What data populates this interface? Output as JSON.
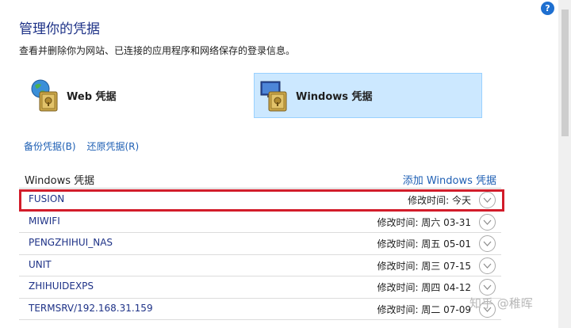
{
  "header": {
    "title": "管理你的凭据",
    "subtitle": "查看并删除你为网站、已连接的应用程序和网络保存的登录信息。",
    "help_glyph": "?"
  },
  "tiles": {
    "web_label": "Web 凭据",
    "windows_label": "Windows 凭据"
  },
  "links": {
    "backup": "备份凭据(B)",
    "restore": "还原凭据(R)"
  },
  "section": {
    "title": "Windows 凭据",
    "add_link": "添加 Windows 凭据"
  },
  "credentials": [
    {
      "name": "FUSION",
      "modified": "修改时间: 今天"
    },
    {
      "name": "MIWIFI",
      "modified": "修改时间: 周六 03-31"
    },
    {
      "name": "PENGZHIHUI_NAS",
      "modified": "修改时间: 周五 05-01"
    },
    {
      "name": "UNIT",
      "modified": "修改时间: 周三 07-15"
    },
    {
      "name": "ZHIHUIDEXPS",
      "modified": "修改时间: 周四 04-12"
    },
    {
      "name": "TERMSRV/192.168.31.159",
      "modified": "修改时间: 周二 07-09"
    }
  ],
  "watermark": "知乎 @稚晖",
  "colors": {
    "title": "#1e3287",
    "link": "#1e5fb4",
    "selected_tile": "#cce8ff",
    "highlight_box": "#d21c2a"
  }
}
